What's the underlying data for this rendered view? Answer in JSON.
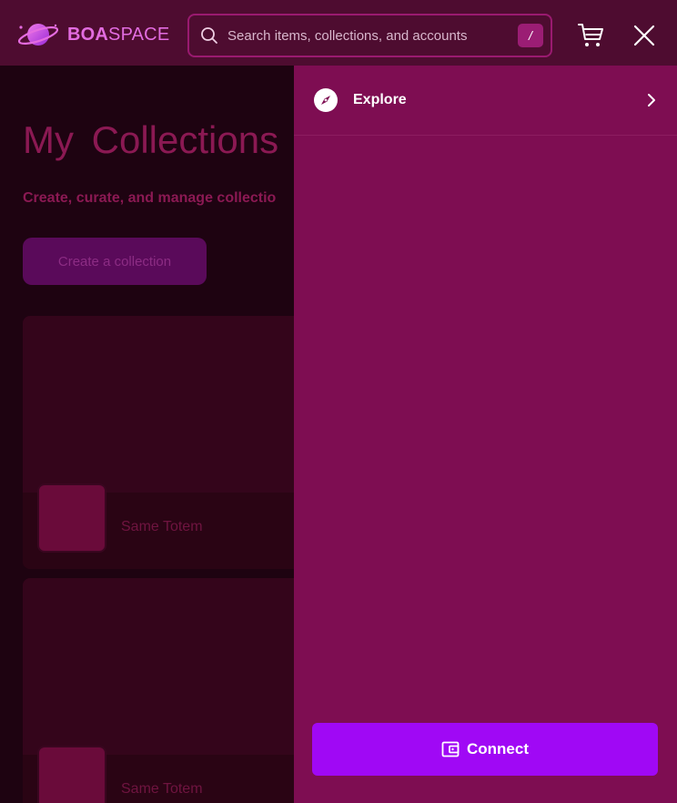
{
  "header": {
    "logo_bold": "BOA",
    "logo_light": "SPACE",
    "search_placeholder": "Search items, collections, and accounts",
    "search_shortcut": "/",
    "cart_icon": "cart-icon",
    "close_icon": "close-icon"
  },
  "main": {
    "title": "My Collections",
    "subtitle": "Create, curate, and manage collectio",
    "create_button": "Create a collection",
    "cards": [
      {
        "name": "Same Totem"
      },
      {
        "name": "Same Totem"
      }
    ]
  },
  "panel": {
    "items": [
      {
        "label": "Explore",
        "icon": "compass-icon"
      }
    ],
    "connect_button": "Connect",
    "connect_icon": "wallet-icon"
  },
  "colors": {
    "header_bg": "#4e0c30",
    "panel_bg": "#7e0d52",
    "accent": "#a008f5",
    "page_bg": "#1e0311"
  }
}
